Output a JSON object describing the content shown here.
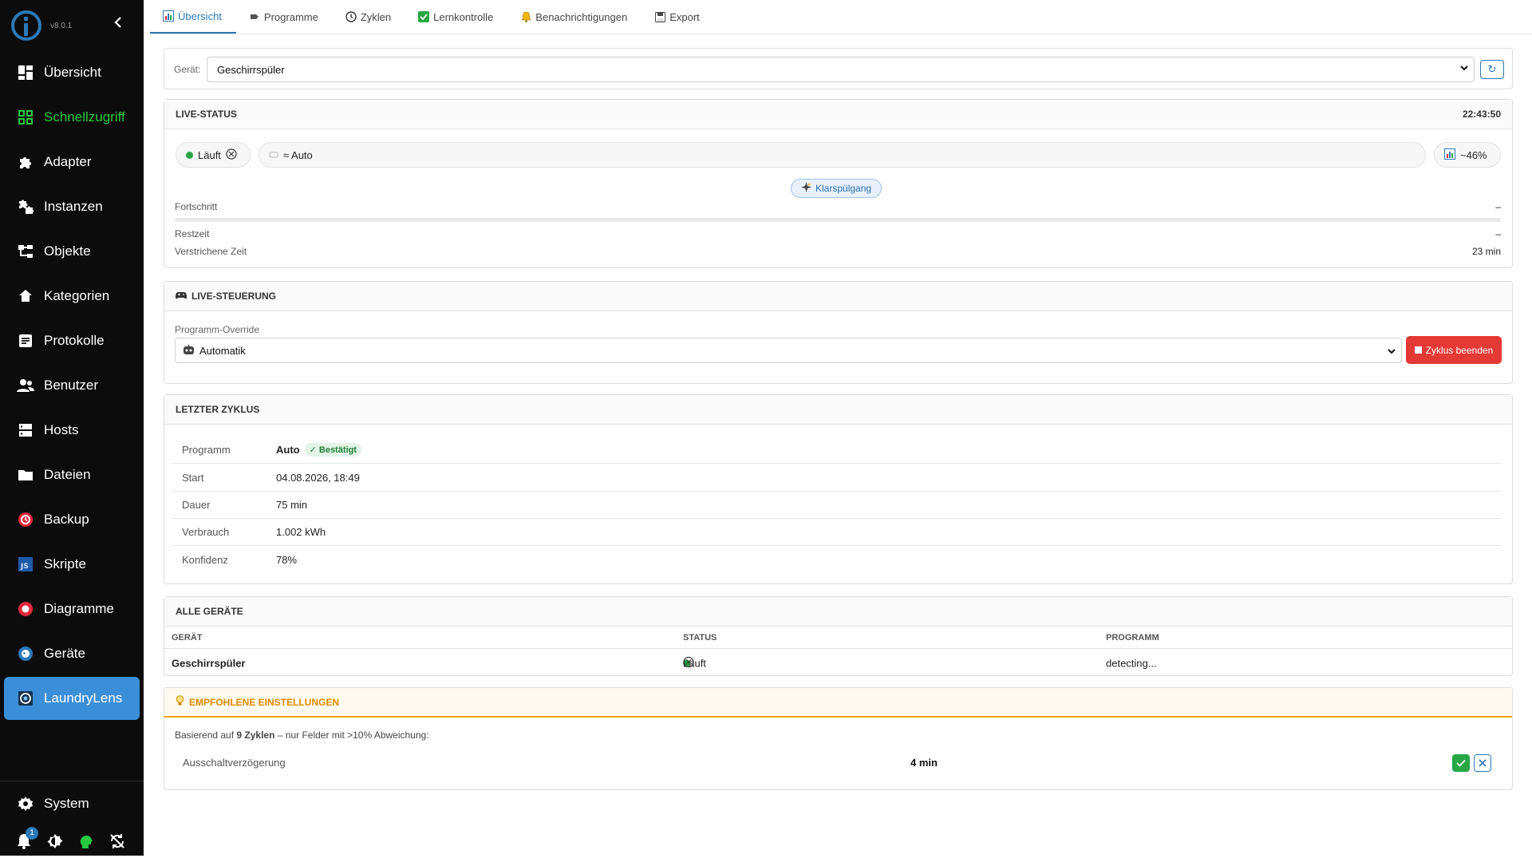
{
  "app": {
    "version": "v8.0.1"
  },
  "sidebar": {
    "items": [
      {
        "label": "Übersicht",
        "icon": "dashboard-icon"
      },
      {
        "label": "Schnellzugriff",
        "icon": "grid-icon"
      },
      {
        "label": "Adapter",
        "icon": "puzzle-icon"
      },
      {
        "label": "Instanzen",
        "icon": "puzzles-icon"
      },
      {
        "label": "Objekte",
        "icon": "tree-icon"
      },
      {
        "label": "Kategorien",
        "icon": "home-category-icon"
      },
      {
        "label": "Protokolle",
        "icon": "log-icon"
      },
      {
        "label": "Benutzer",
        "icon": "users-icon"
      },
      {
        "label": "Hosts",
        "icon": "server-icon"
      },
      {
        "label": "Dateien",
        "icon": "folder-icon"
      },
      {
        "label": "Backup",
        "icon": "backup-icon"
      },
      {
        "label": "Skripte",
        "icon": "js-icon"
      },
      {
        "label": "Diagramme",
        "icon": "chart-icon"
      },
      {
        "label": "Geräte",
        "icon": "devices-icon"
      },
      {
        "label": "LaundryLens",
        "icon": "laundrylens-icon"
      }
    ],
    "system_label": "System",
    "notification_count": "1",
    "colors": {
      "background": "#0c0c0c",
      "active": "#3b8fd9",
      "schnellzugriff": "#27c93f"
    }
  },
  "tabs": [
    {
      "label": "Übersicht",
      "icon": "chart-icon"
    },
    {
      "label": "Programme",
      "icon": "tag-icon"
    },
    {
      "label": "Zyklen",
      "icon": "clock-icon"
    },
    {
      "label": "Lernkontrolle",
      "icon": "check-square-icon"
    },
    {
      "label": "Benachrichtigungen",
      "icon": "bell-icon"
    },
    {
      "label": "Export",
      "icon": "save-icon"
    }
  ],
  "device_selector": {
    "label": "Gerät:",
    "value": "Geschirrspüler",
    "refresh_symbol": "↻"
  },
  "live_status": {
    "title": "LIVE-STATUS",
    "time": "22:43:50",
    "state": "Läuft",
    "program": "≈ Auto",
    "percent": "~46%",
    "phase": "Klarspülgang",
    "progress_label": "Fortschritt",
    "progress_value": "–",
    "progress_fraction": 0,
    "remaining_label": "Restzeit",
    "remaining_value": "–",
    "elapsed_label": "Verstrichene Zeit",
    "elapsed_value": "23 min"
  },
  "live_control": {
    "title": "LIVE-STEUERUNG",
    "override_label": "Programm-Override",
    "override_value": "Automatik",
    "end_button": "Zyklus beenden"
  },
  "last_cycle": {
    "title": "LETZTER ZYKLUS",
    "rows": [
      {
        "key": "Programm",
        "value": "Auto",
        "badge": "✓ Bestätigt"
      },
      {
        "key": "Start",
        "value": "04.08.2026, 18:49"
      },
      {
        "key": "Dauer",
        "value": "75 min"
      },
      {
        "key": "Verbrauch",
        "value": "1.002 kWh"
      },
      {
        "key": "Konfidenz",
        "value": "78%"
      }
    ]
  },
  "all_devices": {
    "title": "ALLE GERÄTE",
    "headers": [
      "GERÄT",
      "STATUS",
      "PROGRAMM"
    ],
    "rows": [
      {
        "device": "Geschirrspüler",
        "status": "Läuft",
        "program": "detecting..."
      }
    ]
  },
  "recommended": {
    "title": "EMPFOHLENE EINSTELLUNGEN",
    "intro_prefix": "Basierend auf ",
    "intro_bold": "9 Zyklen",
    "intro_suffix": " – nur Felder mit >10% Abweichung:",
    "setting_label": "Ausschaltverzögerung",
    "setting_value": "4 min",
    "accent": "#e08a00"
  }
}
